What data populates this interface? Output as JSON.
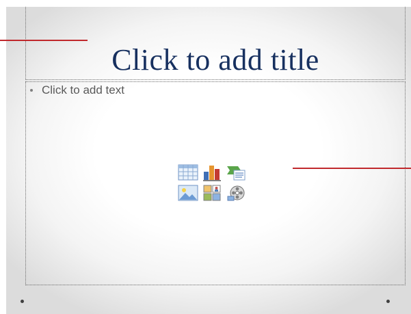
{
  "slide": {
    "title_placeholder": "Click to add title",
    "body_placeholder": "Click to add text",
    "content_icons": [
      {
        "name": "insert-table-icon"
      },
      {
        "name": "insert-chart-icon"
      },
      {
        "name": "insert-smartart-icon"
      },
      {
        "name": "insert-picture-icon"
      },
      {
        "name": "insert-clip-art-icon"
      },
      {
        "name": "insert-media-icon"
      }
    ]
  },
  "colors": {
    "title": "#17305f",
    "body_text": "#595959",
    "callout_line": "#c0282c",
    "placeholder_border": "#6a6a6a"
  }
}
